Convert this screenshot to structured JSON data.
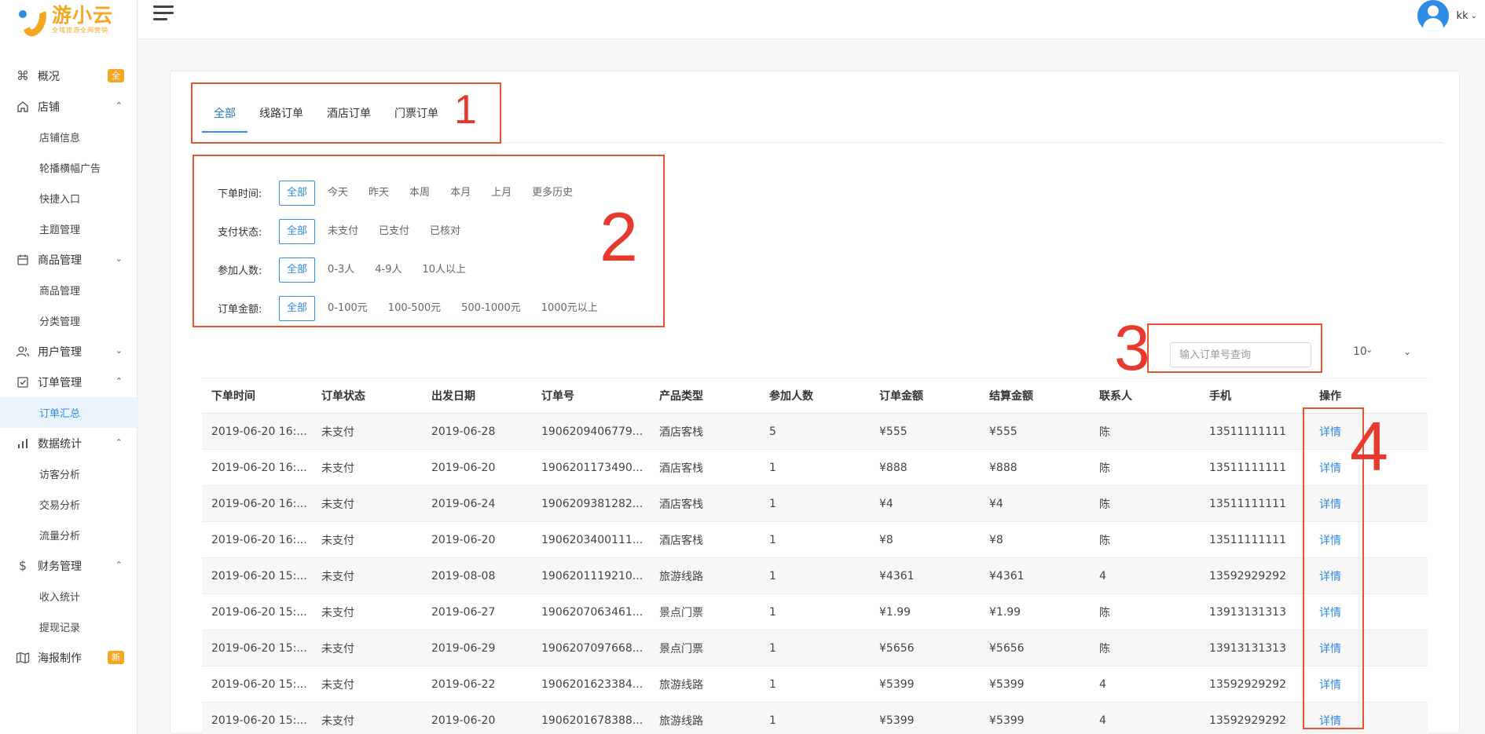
{
  "brand": {
    "name": "游小云",
    "slogan": "全域旅游全网营销"
  },
  "user": {
    "name": "kk"
  },
  "sidebar": {
    "overview": {
      "label": "概况",
      "badge": "全"
    },
    "shop": {
      "label": "店铺",
      "items": [
        "店铺信息",
        "轮播横幅广告",
        "快捷入口",
        "主题管理"
      ]
    },
    "goods": {
      "label": "商品管理",
      "items": [
        "商品管理",
        "分类管理"
      ]
    },
    "users": {
      "label": "用户管理"
    },
    "orders": {
      "label": "订单管理",
      "items": [
        "订单汇总"
      ]
    },
    "stats": {
      "label": "数据统计",
      "items": [
        "访客分析",
        "交易分析",
        "流量分析"
      ]
    },
    "finance": {
      "label": "财务管理",
      "items": [
        "收入统计",
        "提现记录"
      ]
    },
    "poster": {
      "label": "海报制作",
      "badge": "新"
    }
  },
  "tabs": [
    "全部",
    "线路订单",
    "酒店订单",
    "门票订单"
  ],
  "filters": {
    "time": {
      "label": "下单时间:",
      "options": [
        "全部",
        "今天",
        "昨天",
        "本周",
        "本月",
        "上月",
        "更多历史"
      ]
    },
    "pay": {
      "label": "支付状态:",
      "options": [
        "全部",
        "未支付",
        "已支付",
        "已核对"
      ]
    },
    "people": {
      "label": "参加人数:",
      "options": [
        "全部",
        "0-3人",
        "4-9人",
        "10人以上"
      ]
    },
    "amount": {
      "label": "订单金额:",
      "options": [
        "全部",
        "0-100元",
        "100-500元",
        "500-1000元",
        "1000元以上"
      ]
    }
  },
  "search": {
    "placeholder": "输入订单号查询"
  },
  "page_size": "10",
  "annotations": [
    "1",
    "2",
    "3",
    "4"
  ],
  "table": {
    "headers": [
      "下单时间",
      "订单状态",
      "出发日期",
      "订单号",
      "产品类型",
      "参加人数",
      "订单金额",
      "结算金额",
      "联系人",
      "手机",
      "操作"
    ],
    "rows": [
      [
        "2019-06-20 16:...",
        "未支付",
        "2019-06-28",
        "1906209406779...",
        "酒店客栈",
        "5",
        "¥555",
        "¥555",
        "陈",
        "13511111111",
        "详情"
      ],
      [
        "2019-06-20 16:...",
        "未支付",
        "2019-06-20",
        "1906201173490...",
        "酒店客栈",
        "1",
        "¥888",
        "¥888",
        "陈",
        "13511111111",
        "详情"
      ],
      [
        "2019-06-20 16:...",
        "未支付",
        "2019-06-24",
        "1906209381282...",
        "酒店客栈",
        "1",
        "¥4",
        "¥4",
        "陈",
        "13511111111",
        "详情"
      ],
      [
        "2019-06-20 16:...",
        "未支付",
        "2019-06-20",
        "1906203400111...",
        "酒店客栈",
        "1",
        "¥8",
        "¥8",
        "陈",
        "13511111111",
        "详情"
      ],
      [
        "2019-06-20 15:...",
        "未支付",
        "2019-08-08",
        "1906201119210...",
        "旅游线路",
        "1",
        "¥4361",
        "¥4361",
        "4",
        "13592929292",
        "详情"
      ],
      [
        "2019-06-20 15:...",
        "未支付",
        "2019-06-27",
        "1906207063461...",
        "景点门票",
        "1",
        "¥1.99",
        "¥1.99",
        "陈",
        "13913131313",
        "详情"
      ],
      [
        "2019-06-20 15:...",
        "未支付",
        "2019-06-29",
        "1906207097668...",
        "景点门票",
        "1",
        "¥5656",
        "¥5656",
        "陈",
        "13913131313",
        "详情"
      ],
      [
        "2019-06-20 15:...",
        "未支付",
        "2019-06-22",
        "1906201623384...",
        "旅游线路",
        "1",
        "¥5399",
        "¥5399",
        "4",
        "13592929292",
        "详情"
      ],
      [
        "2019-06-20 15:...",
        "未支付",
        "2019-06-20",
        "1906201678388...",
        "旅游线路",
        "1",
        "¥5399",
        "¥5399",
        "4",
        "13592929292",
        "详情"
      ]
    ]
  }
}
